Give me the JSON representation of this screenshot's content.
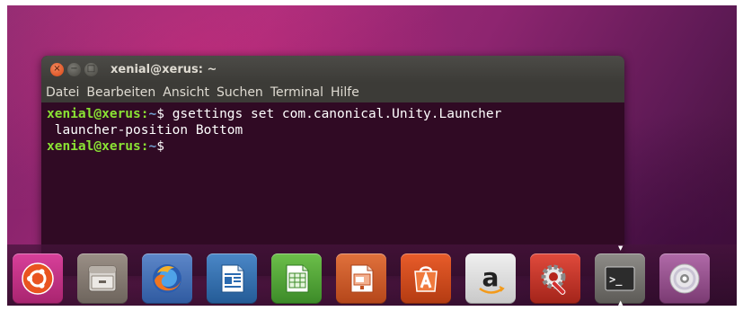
{
  "window": {
    "title": "xenial@xerus: ~",
    "controls": {
      "close": "×",
      "minimize": "−",
      "maximize": "□"
    }
  },
  "menubar": {
    "items": [
      "Datei",
      "Bearbeiten",
      "Ansicht",
      "Suchen",
      "Terminal",
      "Hilfe"
    ]
  },
  "terminal": {
    "lines": [
      {
        "user": "xenial@xerus",
        "colon": ":",
        "path": "~",
        "symbol": "$",
        "command": " gsettings set com.canonical.Unity.Launcher"
      },
      {
        "continuation": " launcher-position Bottom"
      },
      {
        "user": "xenial@xerus",
        "colon": ":",
        "path": "~",
        "symbol": "$",
        "command": ""
      }
    ]
  },
  "launcher": {
    "items": [
      {
        "name": "ubuntu-dash-icon"
      },
      {
        "name": "files-icon"
      },
      {
        "name": "firefox-icon"
      },
      {
        "name": "libreoffice-writer-icon"
      },
      {
        "name": "libreoffice-calc-icon"
      },
      {
        "name": "libreoffice-impress-icon"
      },
      {
        "name": "ubuntu-software-icon"
      },
      {
        "name": "amazon-icon"
      },
      {
        "name": "system-settings-icon"
      },
      {
        "name": "terminal-icon",
        "active": true
      },
      {
        "name": "dvd-drive-icon"
      }
    ],
    "amazon_letter": "a",
    "terminal_glyph": ">_"
  },
  "colors": {
    "terminal_bg": "#300a24",
    "prompt_user": "#8ae234",
    "prompt_path": "#729fcf",
    "titlebar": "#3c3b37",
    "close_button": "#e0592a"
  }
}
